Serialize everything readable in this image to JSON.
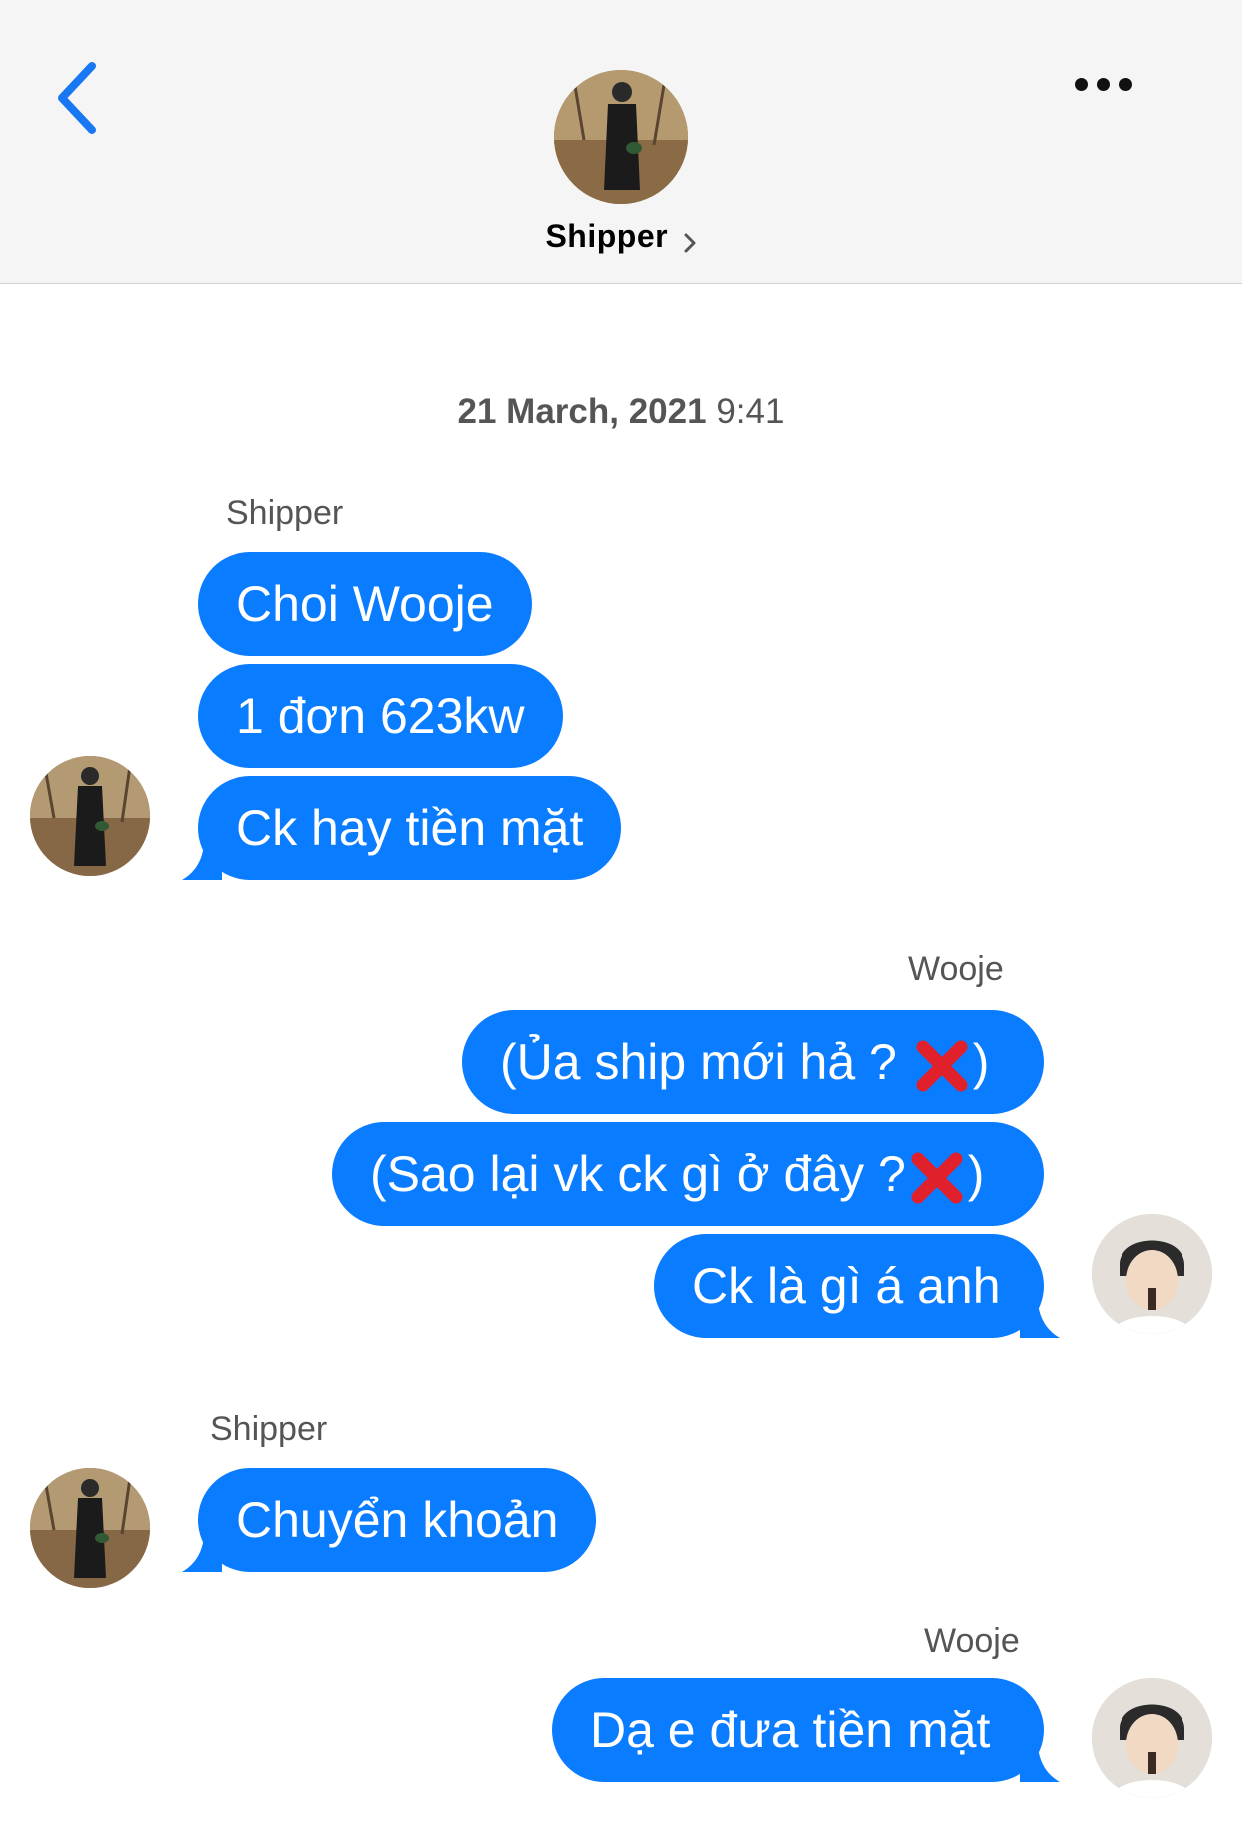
{
  "header": {
    "contact_name": "Shipper",
    "back_icon": "chevron-left-icon",
    "more_icon": "more-horizontal-icon"
  },
  "conversation": {
    "timestamp_date": "21 March, 2021",
    "timestamp_time": "9:41",
    "groups": [
      {
        "sender": "Shipper",
        "messages": [
          "Choi Wooje",
          "1 đơn 623kw",
          "Ck hay tiền mặt"
        ]
      },
      {
        "sender": "Wooje",
        "messages": [
          "(Ủa ship mới hả ? ",
          ")",
          "(Sao lại vk ck gì ở đây ?",
          ")",
          "Ck là gì á anh"
        ]
      },
      {
        "sender": "Shipper",
        "messages": [
          "Chuyển khoản"
        ]
      },
      {
        "sender": "Wooje",
        "messages": [
          "Dạ e đưa tiền mặt"
        ]
      }
    ]
  },
  "colors": {
    "bubble": "#0a7cff",
    "accent": "#0a7cff",
    "x_mark": "#e0202a"
  }
}
